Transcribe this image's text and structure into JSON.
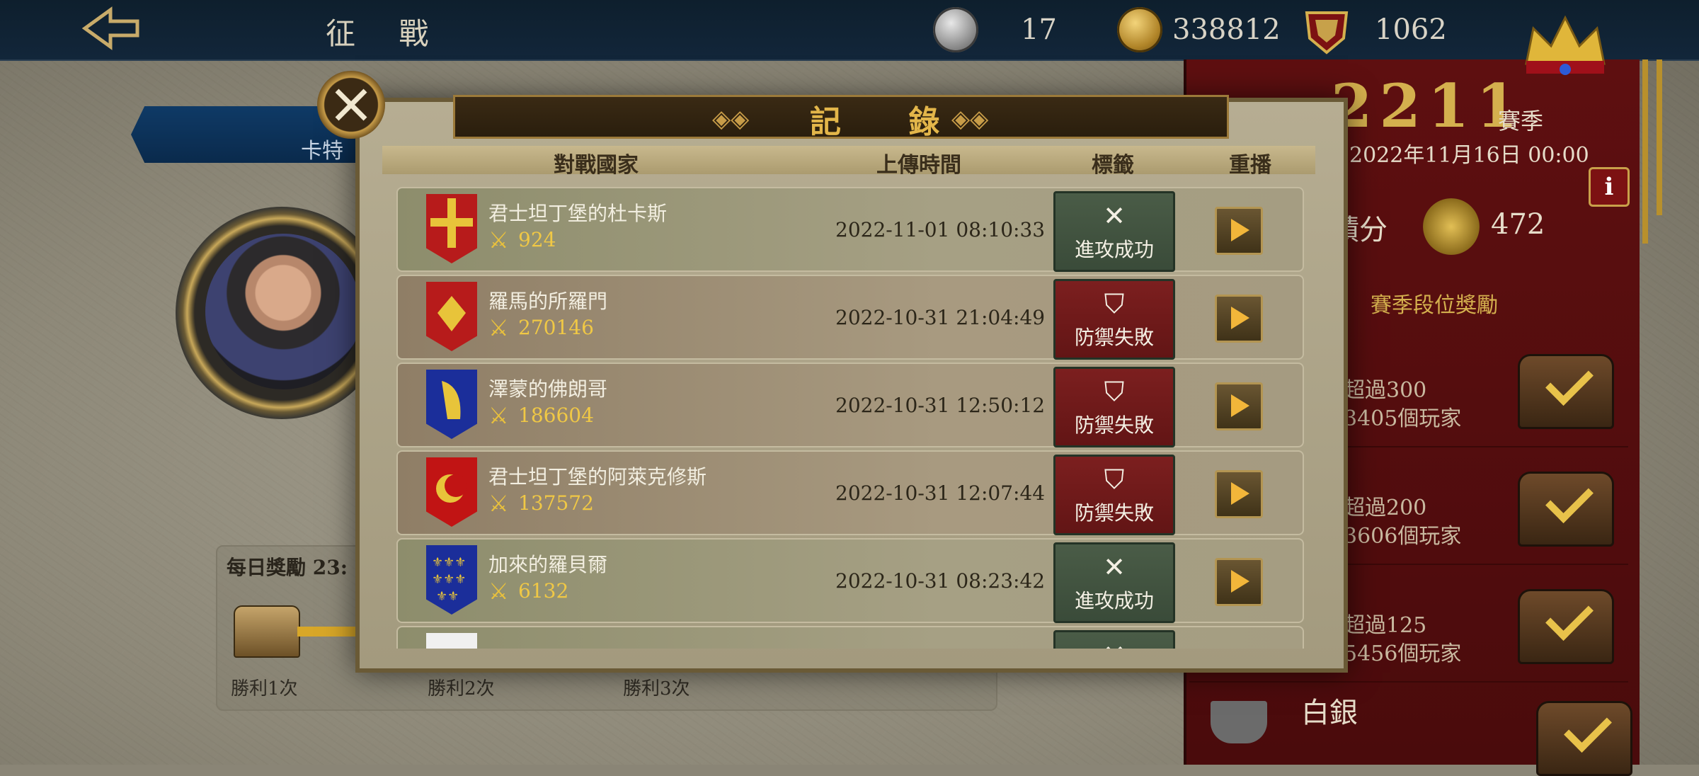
{
  "top_bar": {
    "title": "征 戰",
    "silver": "17",
    "gold": "338812",
    "crest_points": "1062"
  },
  "left_panel": {
    "banner_text": "卡特",
    "daily_reward_title": "每日獎勵 23:",
    "wins": [
      "勝利1次",
      "勝利2次",
      "勝利3次"
    ]
  },
  "right_panel": {
    "season_number": "2211",
    "season_label": "賽季",
    "season_end": "2022年11月16日 00:00",
    "info": "i",
    "points_label": "積分",
    "points_value": "472",
    "season_reward_label": "賽季段位獎勵",
    "tiers": [
      {
        "line1": "超過300",
        "line2": "3405個玩家"
      },
      {
        "line1": "超過200",
        "line2": "3606個玩家"
      },
      {
        "line1": "超過125",
        "line2": "5456個玩家"
      }
    ],
    "silver_tier": "白銀"
  },
  "modal": {
    "title": "記 錄",
    "columns": {
      "country": "對戰國家",
      "time": "上傳時間",
      "tag": "標籤",
      "replay": "重播"
    },
    "rows": [
      {
        "name": "君士坦丁堡的杜卡斯",
        "power": "924",
        "time": "2022-11-01 08:10:33",
        "tag": "進攻成功",
        "type": "atk",
        "shield": "byzantine"
      },
      {
        "name": "羅馬的所羅門",
        "power": "270146",
        "time": "2022-10-31 21:04:49",
        "tag": "防禦失敗",
        "type": "def",
        "shield": "eagle"
      },
      {
        "name": "澤蒙的佛朗哥",
        "power": "186604",
        "time": "2022-10-31 12:50:12",
        "tag": "防禦失敗",
        "type": "def",
        "shield": "harp"
      },
      {
        "name": "君士坦丁堡的阿萊克修斯",
        "power": "137572",
        "time": "2022-10-31 12:07:44",
        "tag": "防禦失敗",
        "type": "def",
        "shield": "crescent"
      },
      {
        "name": "加來的羅貝爾",
        "power": "6132",
        "time": "2022-10-31 08:23:42",
        "tag": "進攻成功",
        "type": "atk",
        "shield": "fleur"
      },
      {
        "name": "",
        "power": "",
        "time": "",
        "tag": "",
        "type": "atk",
        "shield": "white"
      }
    ]
  },
  "colors": {
    "attack_tag": "#3f5140",
    "defense_tag": "#6f1a1a",
    "gold_text": "#e3b64a",
    "panel_red": "#5e0f10"
  }
}
